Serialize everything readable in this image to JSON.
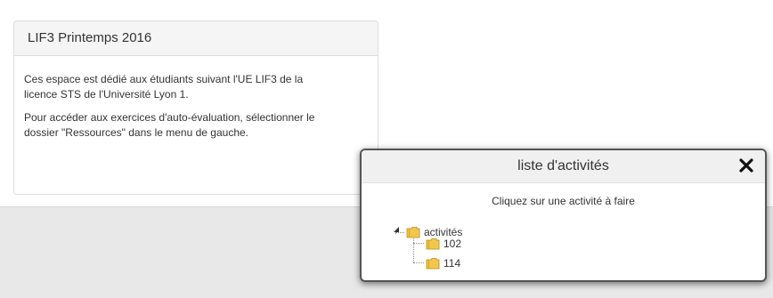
{
  "panel": {
    "title": "LIF3 Printemps 2016",
    "paragraphs": [
      "Ces espace est dédié aux étudiants suivant l'UE LIF3 de la licence STS de l'Université Lyon 1.",
      "Pour accéder aux exercices d'auto-évaluation, sélectionner le dossier \"Ressources\" dans le menu de gauche."
    ]
  },
  "dialog": {
    "title": "liste d'activités",
    "close_icon": "close-icon",
    "subtitle": "Cliquez sur une activité à faire",
    "tree": {
      "root": {
        "label": "activités",
        "icon": "folder-icon",
        "expanded": true
      },
      "children": [
        {
          "label": "102",
          "icon": "folder-icon"
        },
        {
          "label": "114",
          "icon": "folder-icon"
        }
      ]
    }
  },
  "colors": {
    "panel_heading_bg": "#f5f5f5",
    "bottom_band_bg": "#e8e8e8",
    "folder_yellow": "#f2c84b",
    "text": "#333333"
  }
}
